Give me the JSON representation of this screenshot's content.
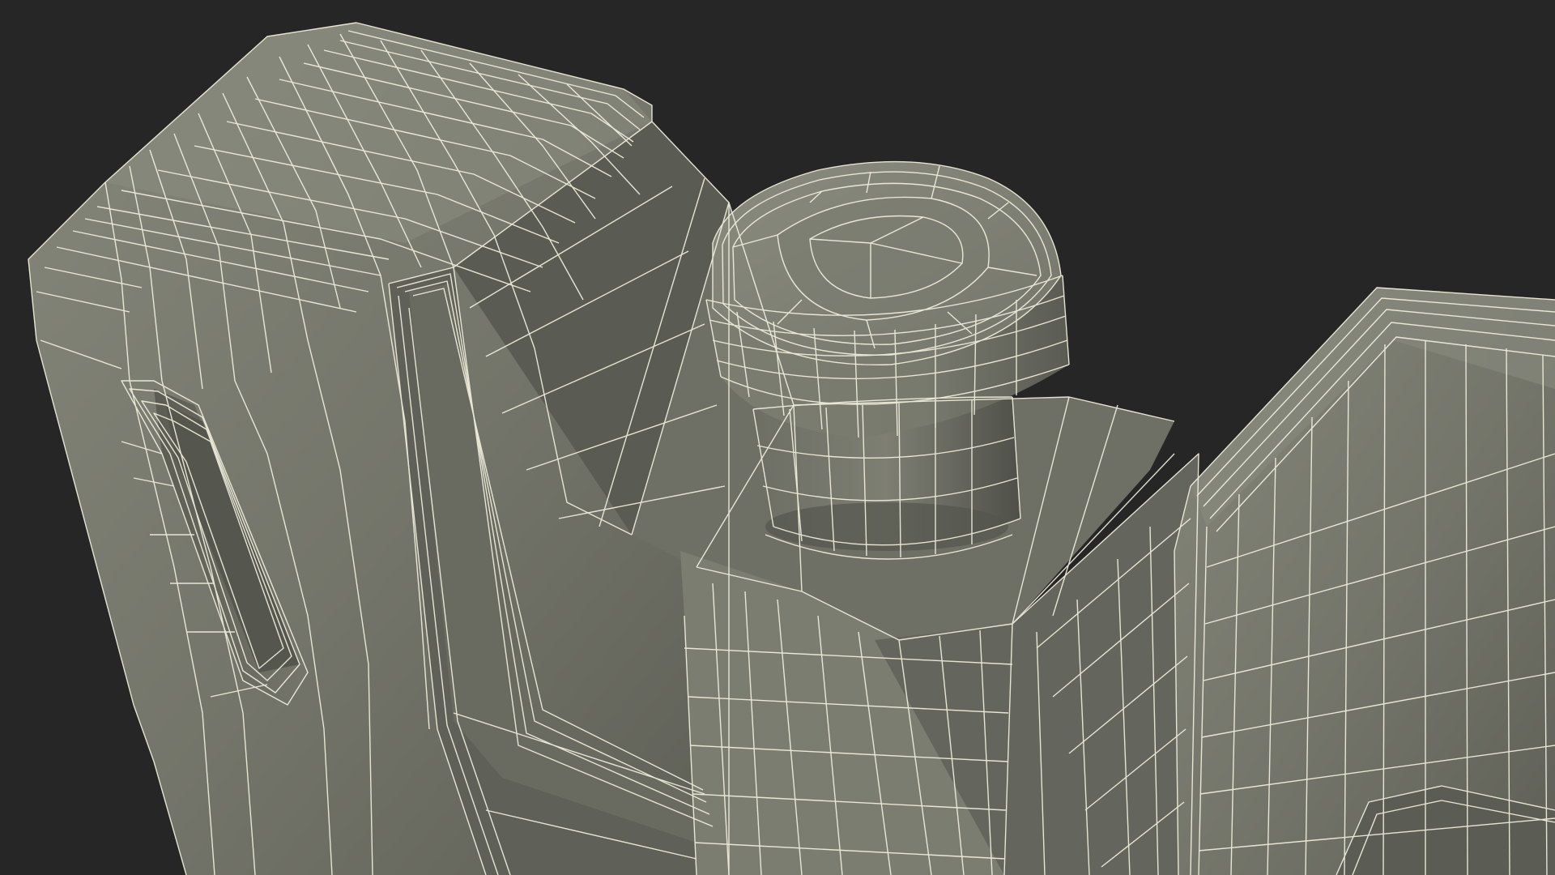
{
  "scene": {
    "subject": "jerrycan-wireframe-render",
    "colors": {
      "background": "#262626",
      "body_light": "#7d7e72",
      "body_mid": "#6f7066",
      "body_dark": "#54554d",
      "body_deep": "#45463f",
      "wire": "#f2f0de"
    }
  }
}
